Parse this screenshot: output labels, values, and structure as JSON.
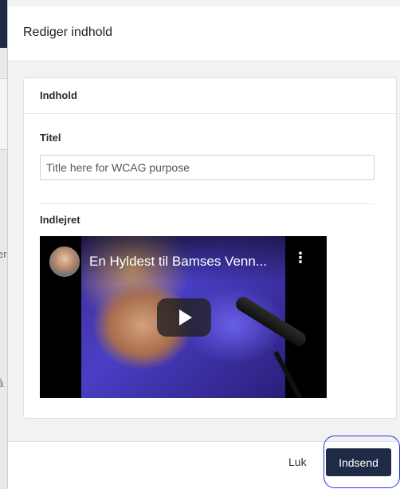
{
  "modal": {
    "title": "Rediger indhold",
    "card": {
      "heading": "Indhold",
      "title_field": {
        "label": "Titel",
        "placeholder": "Title here for WCAG purpose"
      },
      "embed_field": {
        "label": "Indlejret",
        "video": {
          "title": "En Hyldest til Bamses Venn...",
          "more_icon": "vertical-ellipsis-icon",
          "play_icon": "play-icon"
        }
      }
    },
    "footer": {
      "close_label": "Luk",
      "submit_label": "Indsend"
    }
  },
  "background": {
    "fragment_1": "er",
    "fragment_2": "å"
  },
  "colors": {
    "primary": "#1e2a46",
    "annotation": "#2336e6"
  }
}
